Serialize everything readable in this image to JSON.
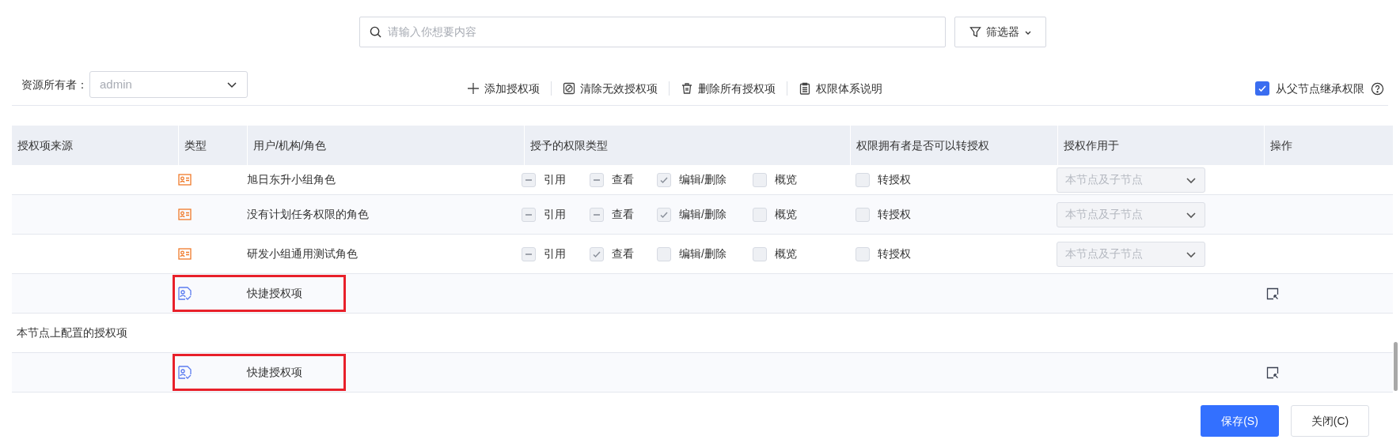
{
  "search": {
    "placeholder": "请输入你想要内容"
  },
  "filter_button": "筛选器",
  "owner": {
    "label": "资源所有者：",
    "value": "admin"
  },
  "toolbar": [
    {
      "label": "添加授权项",
      "kind": "add"
    },
    {
      "label": "清除无效授权项",
      "kind": "clear"
    },
    {
      "label": "删除所有授权项",
      "kind": "delete"
    },
    {
      "label": "权限体系说明",
      "kind": "doc"
    }
  ],
  "inherit": {
    "label": "从父节点继承权限",
    "checked": true
  },
  "table": {
    "columns": [
      "授权项来源",
      "类型",
      "用户/机构/角色",
      "授予的权限类型",
      "权限拥有者是否可以转授权",
      "授权作用于",
      "操作"
    ],
    "rows": [
      {
        "kind": "role",
        "name": "旭日东升小组角色",
        "permissions": [
          {
            "label": "引用",
            "kind": "mixed",
            "checked": true
          },
          {
            "label": "查看",
            "kind": "mixed",
            "checked": true
          },
          {
            "label": "编辑/删除",
            "kind": "box",
            "checked": true
          },
          {
            "label": "概览",
            "kind": "box",
            "checked": false
          }
        ],
        "transfer": {
          "label": "转授权",
          "checked": false
        },
        "scope": "本节点及子节点"
      },
      {
        "kind": "role",
        "name": "没有计划任务权限的角色",
        "permissions": [
          {
            "label": "引用",
            "kind": "mixed",
            "checked": true
          },
          {
            "label": "查看",
            "kind": "mixed",
            "checked": true
          },
          {
            "label": "编辑/删除",
            "kind": "box",
            "checked": true
          },
          {
            "label": "概览",
            "kind": "box",
            "checked": false
          }
        ],
        "transfer": {
          "label": "转授权",
          "checked": false
        },
        "scope": "本节点及子节点"
      },
      {
        "kind": "role",
        "name": "研发小组通用测试角色",
        "permissions": [
          {
            "label": "引用",
            "kind": "mixed",
            "checked": true
          },
          {
            "label": "查看",
            "kind": "box",
            "checked": true
          },
          {
            "label": "编辑/删除",
            "kind": "box",
            "checked": false
          },
          {
            "label": "概览",
            "kind": "box",
            "checked": false
          }
        ],
        "transfer": {
          "label": "转授权",
          "checked": false
        },
        "scope": "本节点及子节点"
      },
      {
        "kind": "quick",
        "name": "快捷授权项",
        "highlighted": true
      },
      {
        "kind": "section",
        "label": "本节点上配置的授权项"
      },
      {
        "kind": "quick",
        "name": "快捷授权项",
        "highlighted": true
      }
    ]
  },
  "buttons": [
    {
      "label": "保存(S)",
      "primary": true
    },
    {
      "label": "关闭(C)",
      "primary": false
    }
  ]
}
